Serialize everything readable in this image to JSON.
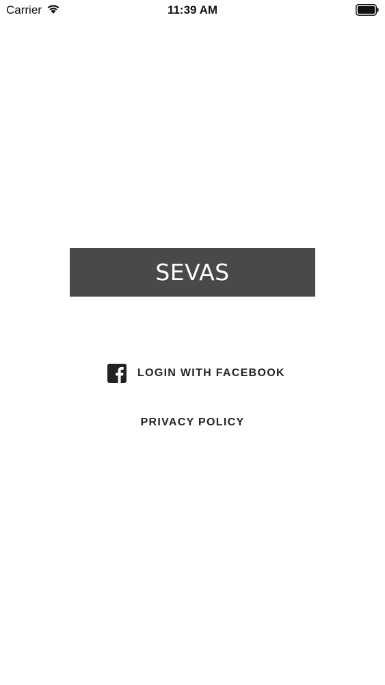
{
  "status_bar": {
    "carrier": "Carrier",
    "time": "11:39 AM",
    "wifi_icon": "wifi-icon",
    "battery_icon": "battery-icon"
  },
  "banner": {
    "title": "SEVAS",
    "background_color": "#4a484b"
  },
  "login": {
    "facebook_label": "LOGIN WITH FACEBOOK",
    "facebook_icon": "facebook-icon"
  },
  "links": {
    "privacy_policy": "PRIVACY POLICY"
  }
}
